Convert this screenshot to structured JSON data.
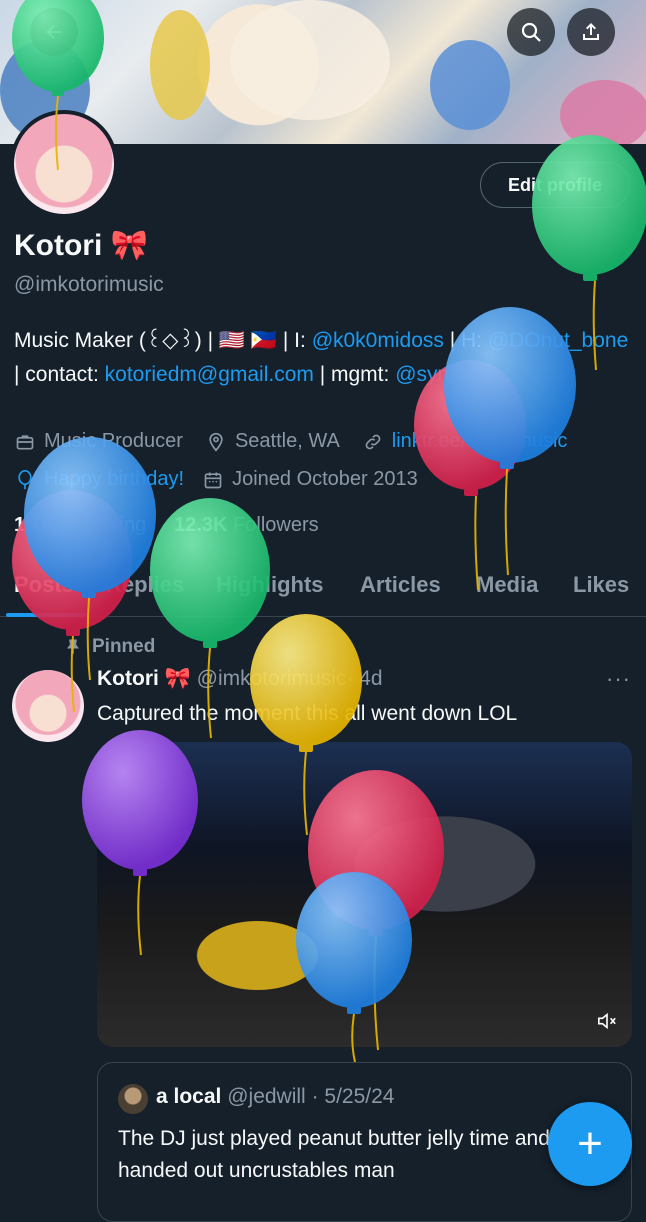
{
  "header": {
    "back_icon": "arrow-left-icon",
    "search_icon": "search-icon",
    "share_icon": "share-icon"
  },
  "profile": {
    "name": "Kotori",
    "name_emoji": "🎀",
    "handle": "@imkotorimusic",
    "edit_button": "Edit profile",
    "bio": {
      "part1": "Music Maker (꒰◇꒱) | 🇺🇸 🇵🇭 | I: ",
      "link1": "@k0k0midoss",
      "part2": " | H: ",
      "link2": "@DOnut_bone",
      "part3": " | contact: ",
      "link3": "kotoriedm@gmail.com",
      "part4": " | mgmt: ",
      "link4": "@synthodj"
    },
    "category": "Music Producer",
    "location": "Seattle, WA",
    "website": "linktr.ee/kotorimusic",
    "birthday": "Happy birthday!",
    "joined": "Joined October 2013",
    "following_count": "1.1K",
    "following_label": "Following",
    "followers_count": "12.3K",
    "followers_label": "Followers"
  },
  "tabs": [
    "Posts",
    "Replies",
    "Highlights",
    "Articles",
    "Media",
    "Likes"
  ],
  "post": {
    "pinned_label": "Pinned",
    "author": "Kotori 🎀",
    "handle": "@imkotorimusic",
    "time": "· 4d",
    "text": "Captured the moment this all went down LOL",
    "more": "···"
  },
  "quote": {
    "author": "a local",
    "handle": "@jedwill",
    "time": "· 5/25/24",
    "text": "The DJ just played peanut butter jelly time and handed out uncrustables man"
  },
  "fab": {
    "label": "+"
  },
  "colors": {
    "accent": "#1d9bf0",
    "background": "#15202b",
    "muted": "#8b98a5"
  }
}
